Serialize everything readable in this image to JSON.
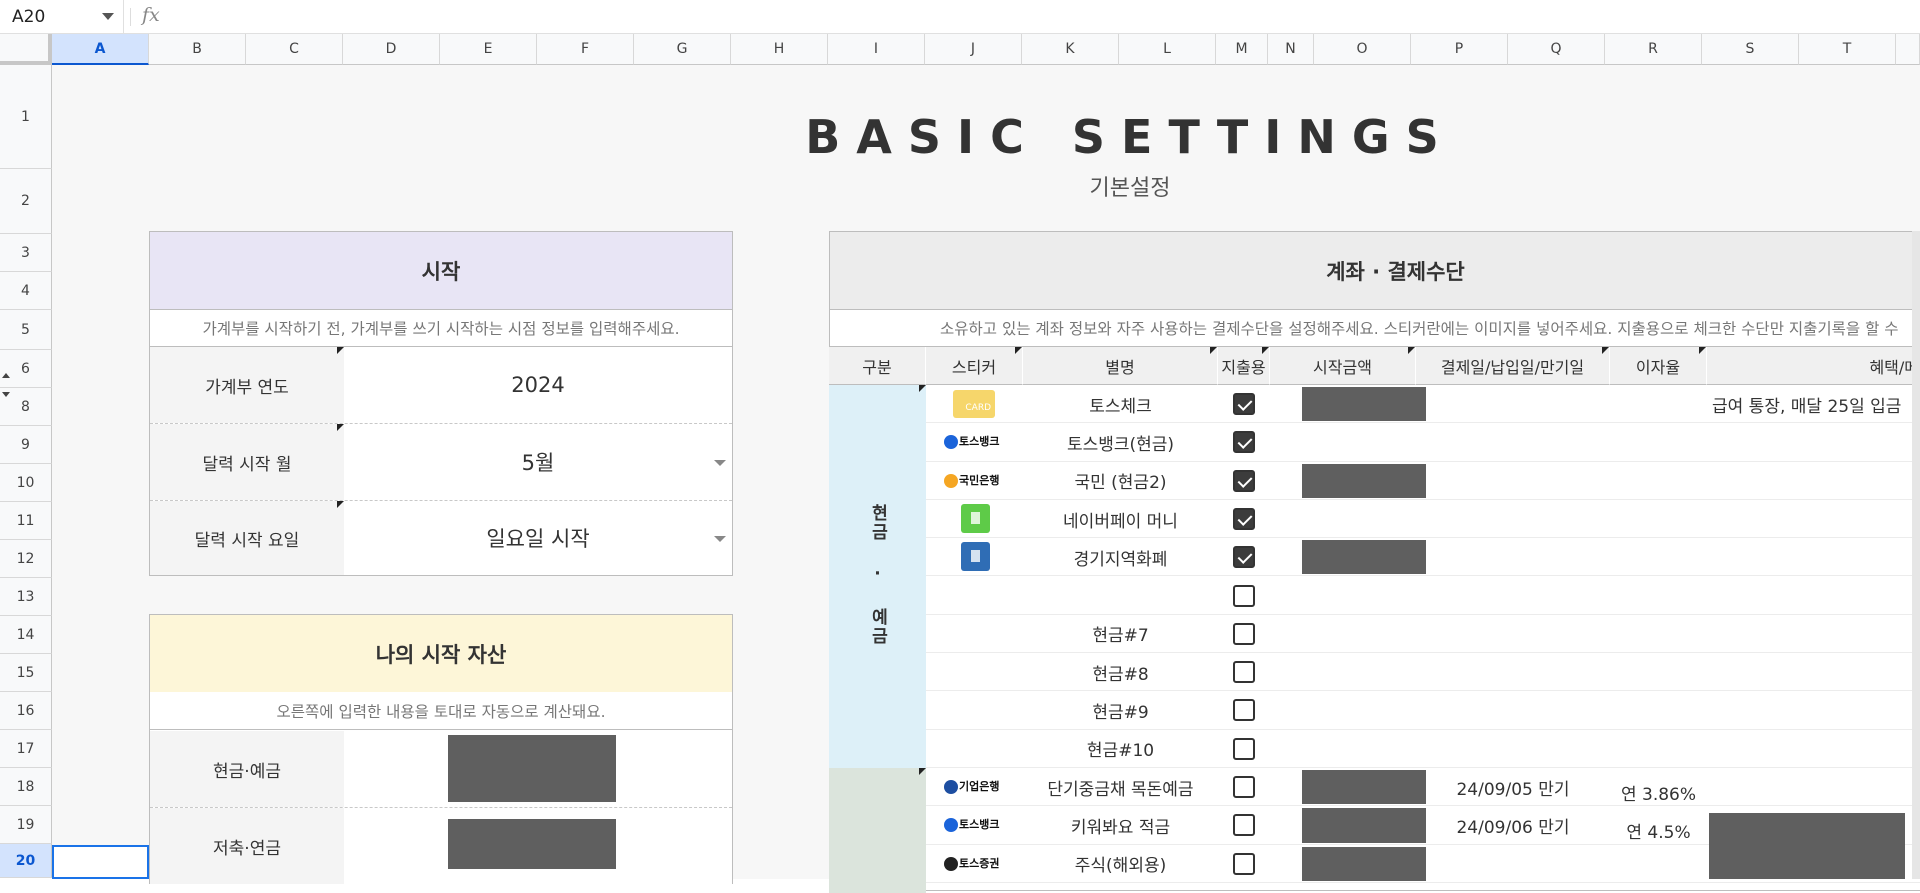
{
  "formula_bar": {
    "cell_ref": "A20",
    "fx": "fx",
    "formula": ""
  },
  "columns": [
    "A",
    "B",
    "C",
    "D",
    "E",
    "F",
    "G",
    "H",
    "I",
    "J",
    "K",
    "L",
    "M",
    "N",
    "O",
    "P",
    "Q",
    "R",
    "S",
    "T"
  ],
  "rows": [
    "1",
    "2",
    "3",
    "4",
    "5",
    "6",
    "8",
    "9",
    "10",
    "11",
    "12",
    "13",
    "14",
    "15",
    "16",
    "17",
    "18",
    "19",
    "20"
  ],
  "selected": {
    "column": "A",
    "row": "20"
  },
  "page": {
    "title": "BASIC SETTINGS",
    "subtitle": "기본설정"
  },
  "start_panel": {
    "title": "시작",
    "description": "가계부를 시작하기 전, 가계부를 쓰기 시작하는 시점 정보를 입력해주세요.",
    "header_color": "#e8e5f5",
    "fields": [
      {
        "label": "가계부 연도",
        "value": "2024"
      },
      {
        "label": "달력 시작 월",
        "value": "5월"
      },
      {
        "label": "달력 시작 요일",
        "value": "일요일 시작"
      }
    ]
  },
  "assets_panel": {
    "title": "나의 시작 자산",
    "description": "오른쪽에 입력한 내용을 토대로 자동으로 계산돼요.",
    "header_color": "#fdf6d8",
    "fields": [
      {
        "label": "현금·예금"
      },
      {
        "label": "저축·연금"
      }
    ]
  },
  "accounts_panel": {
    "title": "계좌 · 결제수단",
    "description": "소유하고 있는 계좌 정보와 자주 사용하는 결제수단을 설정해주세요. 스티커란에는 이미지를 넣어주세요. 지출용으로 체크한 수단만 지출기록을 할 수",
    "headers": [
      "구분",
      "스티커",
      "별명",
      "지출용",
      "시작금액",
      "결제일/납입일/만기일",
      "이자율",
      "혜택/메"
    ],
    "group_cash": {
      "label": "현금 · 예금",
      "color": "#ddf0f8"
    },
    "group_savings_color": "#dbe4dc",
    "rows": [
      {
        "sticker": "card-sticker",
        "sticker_text": "CARD",
        "name": "토스체크",
        "checked": true,
        "amount_redacted": true,
        "date": "",
        "rate": "",
        "benefit": "급여 통장, 매달 25일 입금"
      },
      {
        "sticker": "toss-bank-logo",
        "sticker_text": "토스뱅크",
        "name": "토스뱅크(현금)",
        "checked": true,
        "amount_redacted": false,
        "date": "",
        "rate": "",
        "benefit": ""
      },
      {
        "sticker": "kb-bank-logo",
        "sticker_text": "국민은행",
        "name": "국민 (현금2)",
        "checked": true,
        "amount_redacted": true,
        "date": "",
        "rate": "",
        "benefit": ""
      },
      {
        "sticker": "naverpay-icon",
        "sticker_text": "",
        "name": "네이버페이 머니",
        "checked": true,
        "amount_redacted": false,
        "date": "",
        "rate": "",
        "benefit": ""
      },
      {
        "sticker": "gyeonggi-card-icon",
        "sticker_text": "",
        "name": "경기지역화폐",
        "checked": true,
        "amount_redacted": true,
        "date": "",
        "rate": "",
        "benefit": ""
      },
      {
        "sticker": "",
        "sticker_text": "",
        "name": "",
        "checked": false,
        "amount_redacted": false,
        "date": "",
        "rate": "",
        "benefit": ""
      },
      {
        "sticker": "",
        "sticker_text": "",
        "name": "현금#7",
        "checked": false,
        "amount_redacted": false,
        "date": "",
        "rate": "",
        "benefit": ""
      },
      {
        "sticker": "",
        "sticker_text": "",
        "name": "현금#8",
        "checked": false,
        "amount_redacted": false,
        "date": "",
        "rate": "",
        "benefit": ""
      },
      {
        "sticker": "",
        "sticker_text": "",
        "name": "현금#9",
        "checked": false,
        "amount_redacted": false,
        "date": "",
        "rate": "",
        "benefit": ""
      },
      {
        "sticker": "",
        "sticker_text": "",
        "name": "현금#10",
        "checked": false,
        "amount_redacted": false,
        "date": "",
        "rate": "",
        "benefit": ""
      },
      {
        "sticker": "ibk-bank-logo",
        "sticker_text": "기업은행",
        "name": "단기중금채 목돈예금",
        "checked": false,
        "amount_redacted": true,
        "date": "24/09/05 만기",
        "rate": "연 3.86%",
        "benefit": ""
      },
      {
        "sticker": "toss-bank-logo",
        "sticker_text": "토스뱅크",
        "name": "키워봐요 적금",
        "checked": false,
        "amount_redacted": true,
        "date": "24/09/06 만기",
        "rate": "연 4.5%",
        "benefit": ""
      },
      {
        "sticker": "toss-securities-logo",
        "sticker_text": "토스증권",
        "name": "주식(해외용)",
        "checked": false,
        "amount_redacted": true,
        "date": "",
        "rate": "",
        "benefit": ""
      }
    ]
  }
}
